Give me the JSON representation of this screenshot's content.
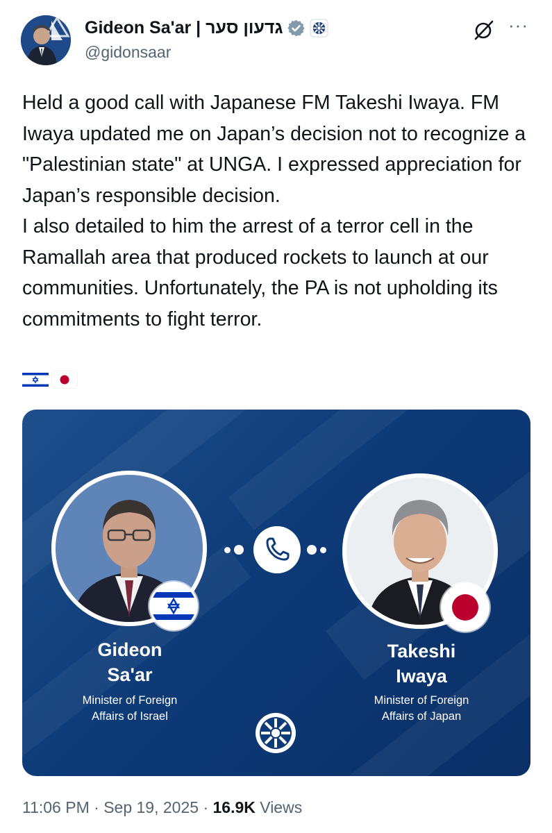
{
  "author": {
    "display_name": "Gideon Sa'ar | גדעון סער",
    "handle": "@gidonsaar",
    "avatar_icon": "profile-photo",
    "verified_icon": "verified-badge-icon",
    "affiliation_icon": "israel-foreign-ministry-emblem-icon"
  },
  "header": {
    "grok_icon": "grok-icon",
    "more_label": "···"
  },
  "tweet": {
    "paragraph_1": "Held a good call with Japanese FM Takeshi Iwaya. FM Iwaya updated me on Japan’s decision not to recognize a \"Palestinian state\" at UNGA. I expressed appreciation for Japan’s responsible decision.",
    "paragraph_2": "I also detailed to him the arrest of a terror cell in the Ramallah area that produced rockets to launch at our communities. Unfortunately, the PA is not upholding its commitments to fight terror.",
    "flags": [
      "israel-flag",
      "japan-flag"
    ]
  },
  "media": {
    "left_person": {
      "name_line_1": "Gideon",
      "name_line_2": "Sa'ar",
      "title_line_1": "Minister of Foreign",
      "title_line_2": "Affairs of Israel",
      "flag": "israel-flag"
    },
    "right_person": {
      "name_line_1": "Takeshi",
      "name_line_2": "Iwaya",
      "title_line_1": "Minister of Foreign",
      "title_line_2": "Affairs of Japan",
      "flag": "japan-flag"
    },
    "call_icon": "phone-icon",
    "emblem_icon": "foreign-ministry-emblem-icon",
    "colors": {
      "background": "#0d3b78",
      "israel_blue": "#0038b8",
      "japan_red": "#bc002d"
    }
  },
  "meta": {
    "time": "11:06 PM",
    "separator": "·",
    "date": "Sep 19, 2025",
    "views_count": "16.9K",
    "views_label": "Views"
  },
  "colors": {
    "text_primary": "#0f1419",
    "text_secondary": "#536471",
    "verified": "#829aab"
  }
}
